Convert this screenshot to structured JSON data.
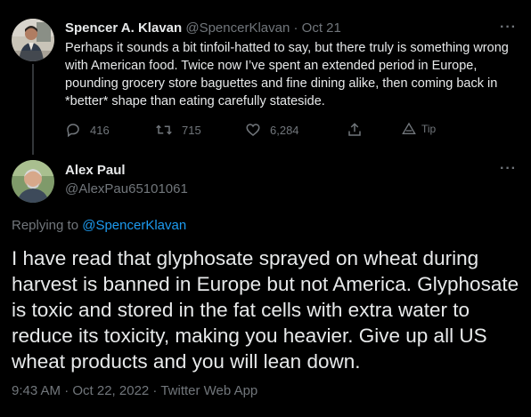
{
  "parent_tweet": {
    "author_name": "Spencer A. Klavan",
    "author_handle": "@SpencerKlavan",
    "separator": "·",
    "date": "Oct 21",
    "more_label": "···",
    "text": "Perhaps it sounds a bit tinfoil-hatted to say, but there truly is something wrong with American food. Twice now I’ve spent an extended period in Europe, pounding grocery store baguettes and fine dining alike, then coming back in *better* shape than eating carefully stateside.",
    "actions": {
      "reply_count": "416",
      "retweet_count": "715",
      "like_count": "6,284",
      "tip_label": "Tip"
    }
  },
  "reply_tweet": {
    "author_name": "Alex Paul",
    "author_handle": "@AlexPau65101061",
    "more_label": "···",
    "replying_prefix": "Replying to",
    "replying_to": "@SpencerKlavan",
    "text": "I have read that glyphosate sprayed on wheat during harvest is banned in Europe but not America. Glyphosate is toxic and stored in the fat cells with extra  water to reduce its toxicity, making you heavier. Give up all US wheat  products and you will lean down.",
    "time": "9:43 AM · Oct 22, 2022 · Twitter Web App"
  },
  "icons": [
    "reply-icon",
    "retweet-icon",
    "like-icon",
    "share-icon",
    "tip-icon",
    "more-icon"
  ],
  "colors": {
    "background": "#000000",
    "text": "#e7e9ea",
    "muted": "#71767b",
    "link": "#1d9bf0",
    "thread_line": "#333639"
  }
}
